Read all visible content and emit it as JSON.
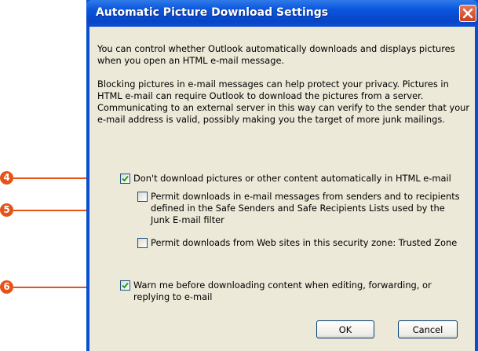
{
  "dialog": {
    "title": "Automatic Picture Download Settings",
    "intro_text": "You can control whether Outlook automatically downloads and displays pictures when you open an HTML e-mail message.",
    "privacy_text": "Blocking pictures in e-mail messages can help protect your privacy. Pictures in HTML e-mail can require Outlook to download the pictures from a server. Communicating to an external server in this way can verify to the sender that your e-mail address is valid, possibly making you the target of more junk mailings."
  },
  "options": {
    "dont_download": {
      "label": "Don't download pictures or other content automatically in HTML e-mail",
      "checked": true
    },
    "permit_safe_senders": {
      "label": "Permit downloads in e-mail messages from senders and to recipients defined in the Safe Senders and Safe Recipients Lists used by the Junk E-mail filter",
      "checked": false
    },
    "permit_web_sites": {
      "label": "Permit downloads from Web sites in this security zone: Trusted Zone",
      "checked": false
    },
    "warn_before_download": {
      "label": "Warn me before downloading content when editing, forwarding, or replying to e-mail",
      "checked": true
    }
  },
  "buttons": {
    "ok": "OK",
    "cancel": "Cancel"
  },
  "callouts": {
    "c4": "4",
    "c5": "5",
    "c6": "6"
  },
  "colors": {
    "callout": "#e65217",
    "titlebar": "#0b56dd",
    "dialog_face": "#ece9d8",
    "close_button": "#d4532c"
  },
  "icons": {
    "close": "close-icon",
    "checkmark": "checkmark-icon"
  }
}
